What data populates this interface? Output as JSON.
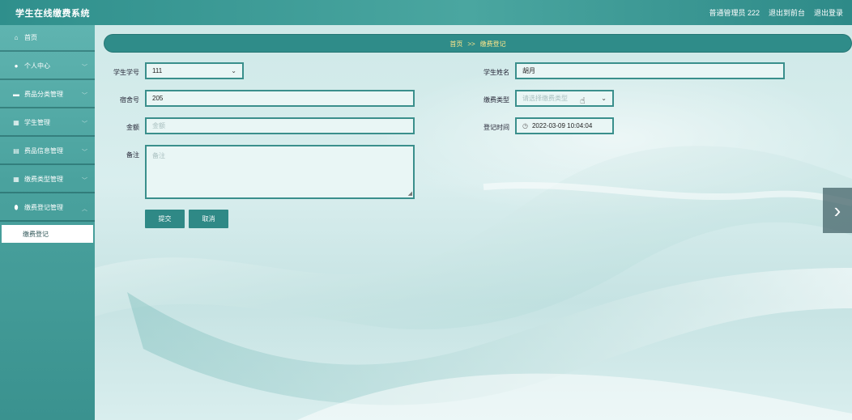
{
  "header": {
    "title": "学生在线缴费系统",
    "user_label": "普通管理员 222",
    "back_label": "退出到前台",
    "logout_label": "退出登录"
  },
  "sidebar": {
    "items": [
      {
        "label": "首页",
        "icon": "home-icon"
      },
      {
        "label": "个人中心",
        "icon": "user-icon"
      },
      {
        "label": "费品分类管理",
        "icon": "monitor-icon"
      },
      {
        "label": "学生管理",
        "icon": "grid-icon"
      },
      {
        "label": "费品信息管理",
        "icon": "clipboard-icon"
      },
      {
        "label": "缴费类型管理",
        "icon": "grid-icon"
      },
      {
        "label": "缴费登记管理",
        "icon": "pin-icon"
      }
    ],
    "active_sub": "缴费登记"
  },
  "breadcrumb": {
    "home": "首页",
    "separator": ">>",
    "current": "缴费登记"
  },
  "form": {
    "student_no": {
      "label": "学生学号",
      "value": "111"
    },
    "student_name": {
      "label": "学生姓名",
      "value": "胡月"
    },
    "dorm": {
      "label": "宿舍号",
      "value": "205"
    },
    "fee_type": {
      "label": "缴费类型",
      "placeholder": "请选择缴费类型"
    },
    "amount": {
      "label": "金额",
      "placeholder": "金额"
    },
    "reg_time": {
      "label": "登记时间",
      "value": "2022-03-09 10:04:04"
    },
    "remark": {
      "label": "备注",
      "placeholder": "备注"
    }
  },
  "buttons": {
    "submit": "提交",
    "cancel": "取消"
  },
  "colors": {
    "accent": "#2f8c89",
    "breadcrumb_text": "#ffe68a"
  }
}
